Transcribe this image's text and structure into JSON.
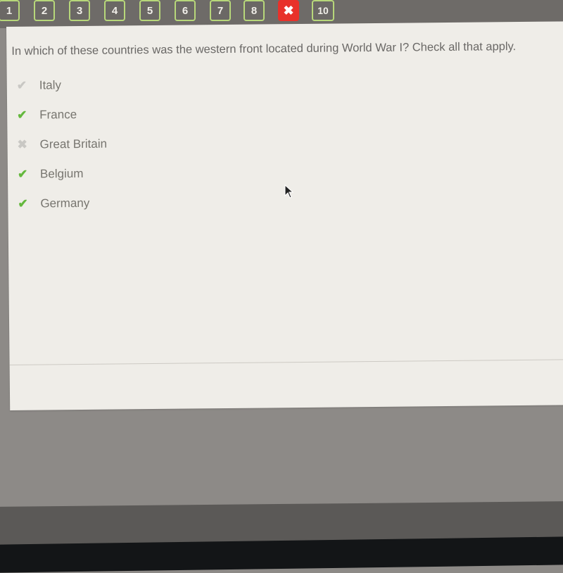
{
  "question_nav": {
    "items": [
      {
        "label": "1",
        "state": "default"
      },
      {
        "label": "2",
        "state": "default"
      },
      {
        "label": "3",
        "state": "default"
      },
      {
        "label": "4",
        "state": "default"
      },
      {
        "label": "5",
        "state": "default"
      },
      {
        "label": "6",
        "state": "default"
      },
      {
        "label": "7",
        "state": "default"
      },
      {
        "label": "8",
        "state": "default"
      },
      {
        "label": "✖",
        "state": "incorrect",
        "icon": "x-icon"
      },
      {
        "label": "10",
        "state": "default"
      }
    ]
  },
  "question": {
    "text": "In which of these countries was the western front located during World War I? Check all that apply."
  },
  "options": [
    {
      "label": "Italy",
      "mark": "✔",
      "mark_icon": "check-icon",
      "status": "not-selected"
    },
    {
      "label": "France",
      "mark": "✔",
      "mark_icon": "check-icon",
      "status": "correct"
    },
    {
      "label": "Great Britain",
      "mark": "✖",
      "mark_icon": "x-icon",
      "status": "not-selected"
    },
    {
      "label": "Belgium",
      "mark": "✔",
      "mark_icon": "check-icon",
      "status": "correct"
    },
    {
      "label": "Germany",
      "mark": "✔",
      "mark_icon": "check-icon",
      "status": "correct"
    }
  ],
  "colors": {
    "correct": "#64b83d",
    "incorrect": "#e8312a",
    "nav_border": "#b7d77a"
  }
}
